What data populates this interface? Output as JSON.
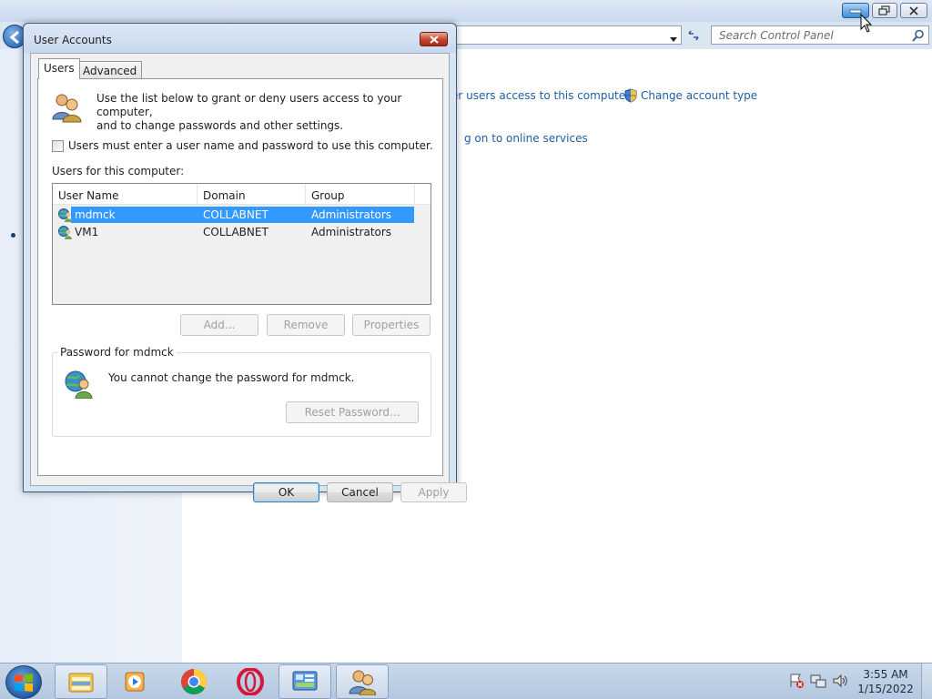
{
  "control_panel": {
    "search": {
      "placeholder": "Search Control Panel"
    },
    "links": {
      "grant_access": "er users access to this computer",
      "change_account_type": "Change account type",
      "online_services": "g on to online services"
    }
  },
  "dialog": {
    "title": "User Accounts",
    "tabs": [
      {
        "label": "Users",
        "selected": true
      },
      {
        "label": "Advanced",
        "selected": false
      }
    ],
    "intro_line1": "Use the list below to grant or deny users access to your computer,",
    "intro_line2": "and to change passwords and other settings.",
    "require_login_checkbox": {
      "label": "Users must enter a user name and password to use this computer.",
      "checked": false
    },
    "users_label": "Users for this computer:",
    "columns": [
      "User Name",
      "Domain",
      "Group"
    ],
    "users": [
      {
        "name": "mdmck",
        "domain": "COLLABNET",
        "group": "Administrators",
        "selected": true
      },
      {
        "name": "VM1",
        "domain": "COLLABNET",
        "group": "Administrators",
        "selected": false
      }
    ],
    "buttons": {
      "add": "Add...",
      "remove": "Remove",
      "properties": "Properties",
      "reset_password": "Reset Password...",
      "ok": "OK",
      "cancel": "Cancel",
      "apply": "Apply"
    },
    "password_group": {
      "title": "Password for mdmck",
      "message": "You cannot change the password for mdmck."
    }
  },
  "taskbar": {
    "pinned": [
      "explorer-icon",
      "media-player-icon",
      "chrome-icon",
      "opera-icon",
      "control-panel-icon",
      "user-accounts-icon"
    ],
    "clock": {
      "time": "3:55 AM",
      "date": "1/15/2022"
    }
  },
  "colors": {
    "selection": "#3399ff",
    "link": "#1e5ea7",
    "close_button": "#c4442a"
  }
}
